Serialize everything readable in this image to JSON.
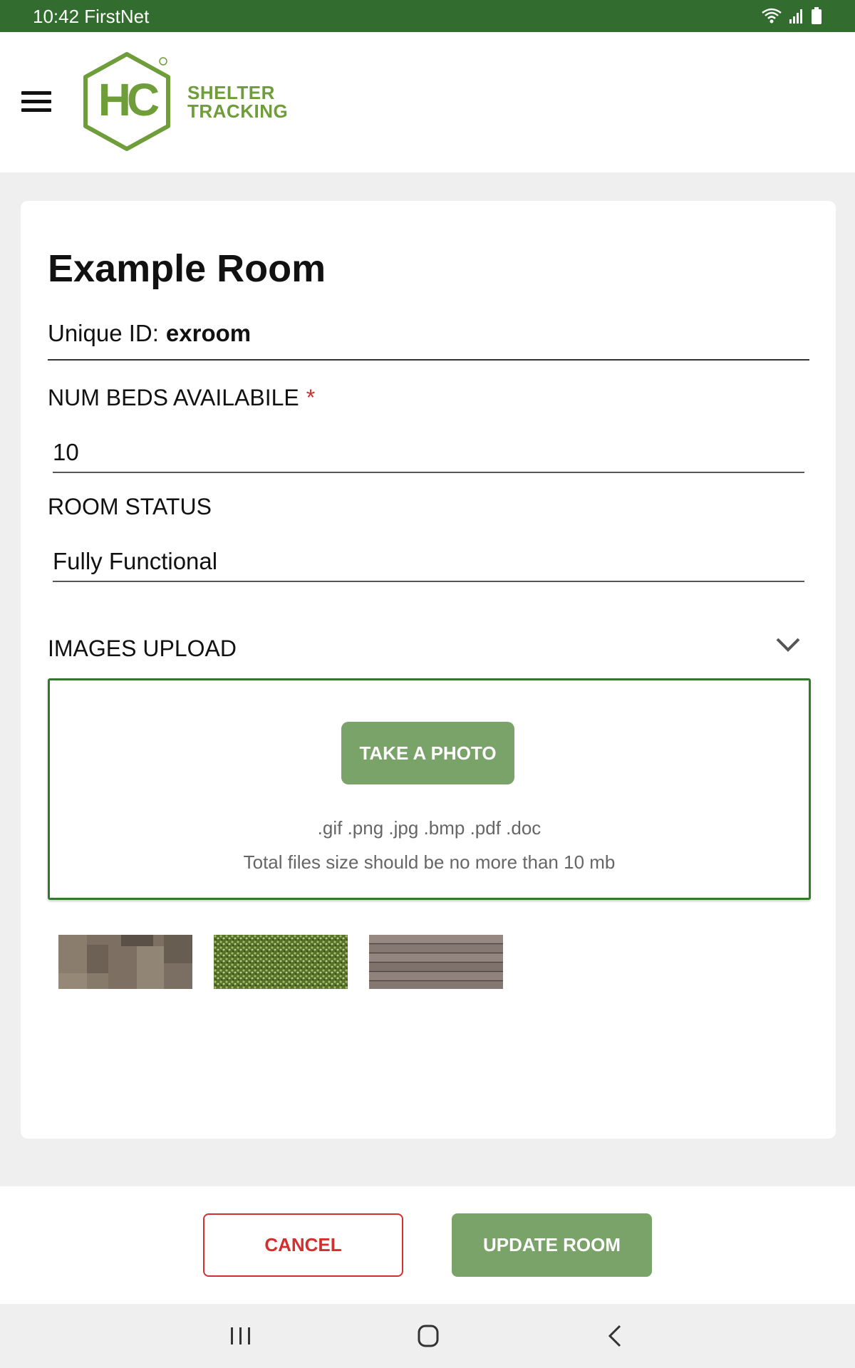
{
  "status_bar": {
    "time_carrier": "10:42 FirstNet",
    "icons": [
      "wifi-icon",
      "signal-icon",
      "battery-icon"
    ]
  },
  "header": {
    "menu_icon": "hamburger-menu-icon",
    "logo_text": "HC",
    "brand_line1": "SHELTER",
    "brand_line2": "TRACKING"
  },
  "room": {
    "title": "Example Room",
    "unique_id_label": "Unique ID:",
    "unique_id_value": "exroom"
  },
  "form": {
    "beds_label": "NUM BEDS AVAILABILE",
    "beds_required_mark": "*",
    "beds_value": "10",
    "status_label": "ROOM STATUS",
    "status_value": "Fully Functional",
    "images_label": "IMAGES UPLOAD",
    "take_photo_label": "TAKE A PHOTO",
    "file_types_hint": ".gif .png .jpg .bmp .pdf .doc",
    "size_hint": "Total files size should be no more than 10 mb"
  },
  "thumbnails": [
    "carpet-image",
    "grass-image",
    "wood-deck-image"
  ],
  "footer": {
    "cancel_label": "CANCEL",
    "update_label": "UPDATE ROOM"
  },
  "colors": {
    "status_bar": "#336c2f",
    "brand_green": "#6f9d3a",
    "button_green": "#79a368",
    "upload_border": "#2f7a2b",
    "cancel_red": "#d32f2f"
  }
}
